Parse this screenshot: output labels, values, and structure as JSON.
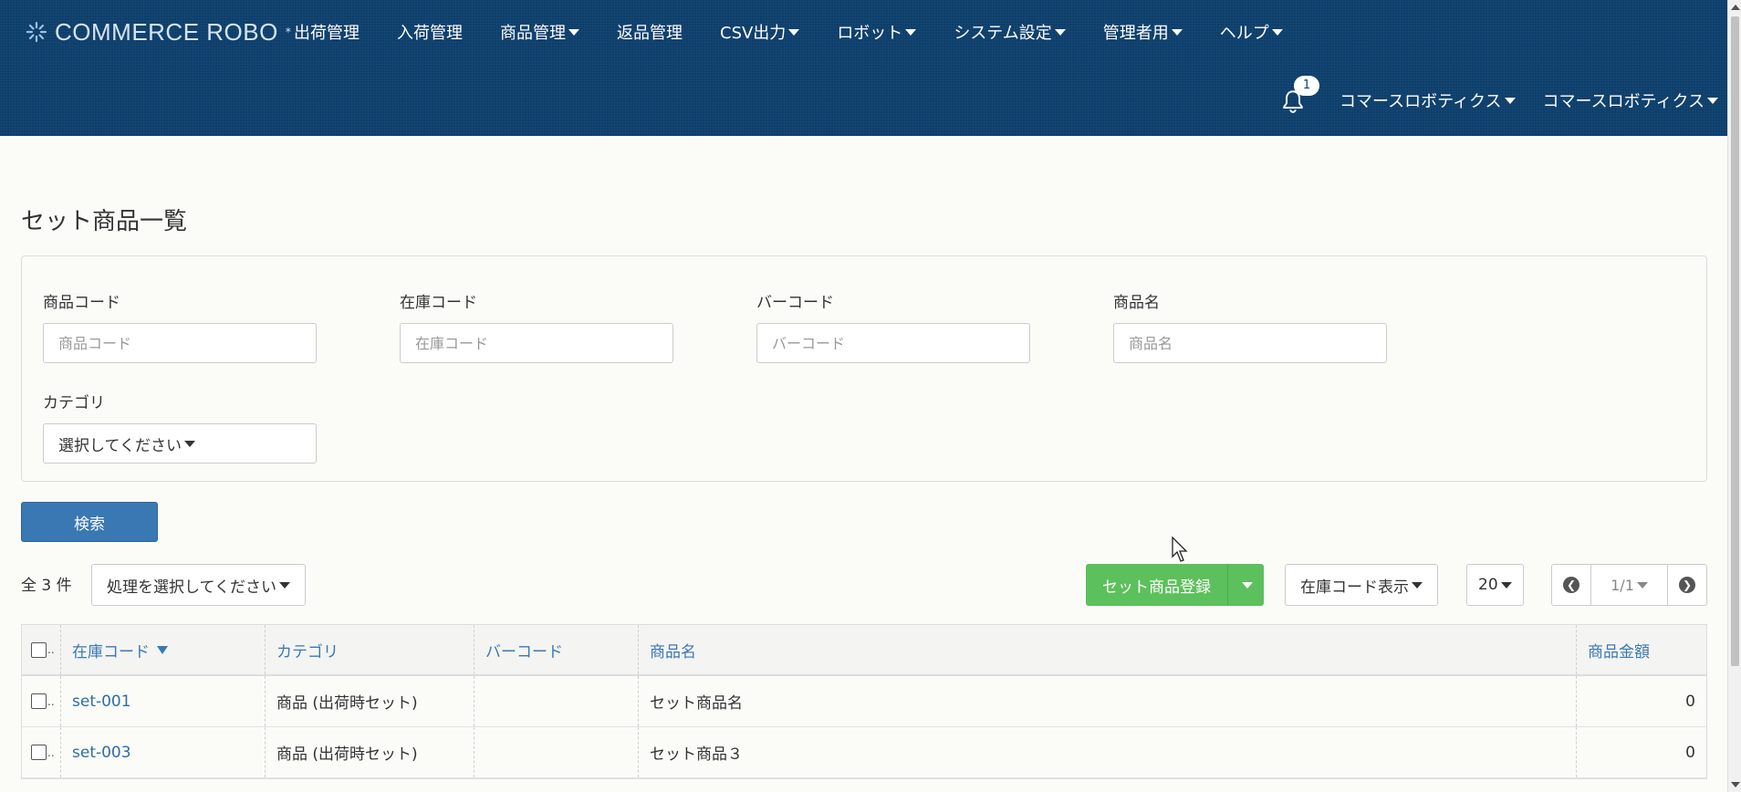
{
  "brand": {
    "name": "COMMERCE ROBO",
    "mark": "*"
  },
  "menu": [
    {
      "label": "出荷管理",
      "dropdown": false
    },
    {
      "label": "入荷管理",
      "dropdown": false
    },
    {
      "label": "商品管理",
      "dropdown": true
    },
    {
      "label": "返品管理",
      "dropdown": false
    },
    {
      "label": "CSV出力",
      "dropdown": true
    },
    {
      "label": "ロボット",
      "dropdown": true
    },
    {
      "label": "システム設定",
      "dropdown": true
    },
    {
      "label": "管理者用",
      "dropdown": true
    },
    {
      "label": "ヘルプ",
      "dropdown": true
    }
  ],
  "nav_right": {
    "notification_count": "1",
    "company": "コマースロボティクス",
    "user": "コマースロボティクス"
  },
  "page": {
    "title": "セット商品一覧"
  },
  "search": {
    "product_code": {
      "label": "商品コード",
      "placeholder": "商品コード",
      "value": ""
    },
    "stock_code": {
      "label": "在庫コード",
      "placeholder": "在庫コード",
      "value": ""
    },
    "barcode": {
      "label": "バーコード",
      "placeholder": "バーコード",
      "value": ""
    },
    "product_name": {
      "label": "商品名",
      "placeholder": "商品名",
      "value": ""
    },
    "category": {
      "label": "カテゴリ",
      "selected": "選択してください"
    },
    "submit_label": "検索"
  },
  "toolbar": {
    "total": "全 3 件",
    "action_select": "処理を選択してください",
    "register_label": "セット商品登録",
    "display_toggle": "在庫コード表示",
    "per_page": "20",
    "page_indicator": "1/1"
  },
  "table": {
    "columns": [
      "在庫コード",
      "カテゴリ",
      "バーコード",
      "商品名",
      "商品金額"
    ],
    "sort_column": "在庫コード",
    "rows": [
      {
        "stock_code": "set-001",
        "category": "商品 (出荷時セット)",
        "barcode": "",
        "name": "セット商品名",
        "price": "0"
      },
      {
        "stock_code": "set-003",
        "category": "商品 (出荷時セット)",
        "barcode": "",
        "name": "セット商品３",
        "price": "0"
      }
    ]
  },
  "colors": {
    "navbar": "#0d3e6b",
    "primary": "#3a78b4",
    "success": "#5cc05c",
    "background": "#fbfbf8"
  }
}
